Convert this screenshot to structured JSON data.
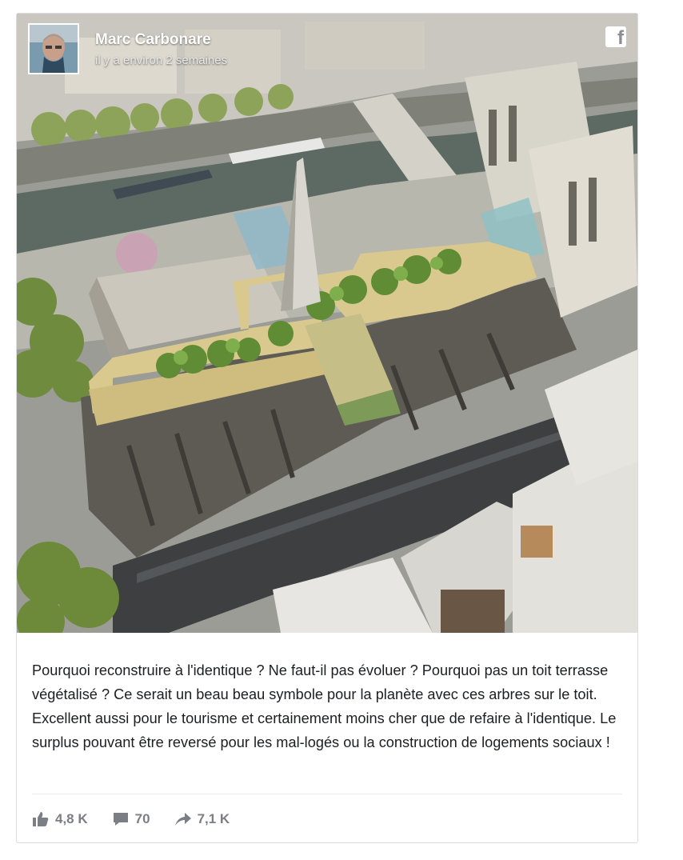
{
  "post": {
    "author": "Marc Carbonare",
    "timestamp": "il y a environ 2 semaines",
    "platform_icon": "facebook-icon",
    "platform_glyph": "f",
    "text": "Pourquoi reconstruire à l'identique ? Ne faut-il pas évoluer ? Pourquoi pas un toit terrasse végétalisé ? Ce serait un beau beau symbole pour la planète avec ces arbres sur le toit. Excellent aussi pour le tourisme et certainement moins cher que de refaire à l'identique. Le surplus pouvant être reversé pour les mal-logés ou la construction de logements sociaux !",
    "image_icon": "photo-notre-dame-rooftop-garden"
  },
  "stats": {
    "likes": "4,8 K",
    "likes_icon": "thumbs-up-icon",
    "comments": "70",
    "comments_icon": "comment-icon",
    "shares": "7,1 K",
    "shares_icon": "share-arrow-icon"
  },
  "colors": {
    "text": "#1c1e21",
    "muted": "#7b7f85",
    "border": "#dcdde1"
  }
}
